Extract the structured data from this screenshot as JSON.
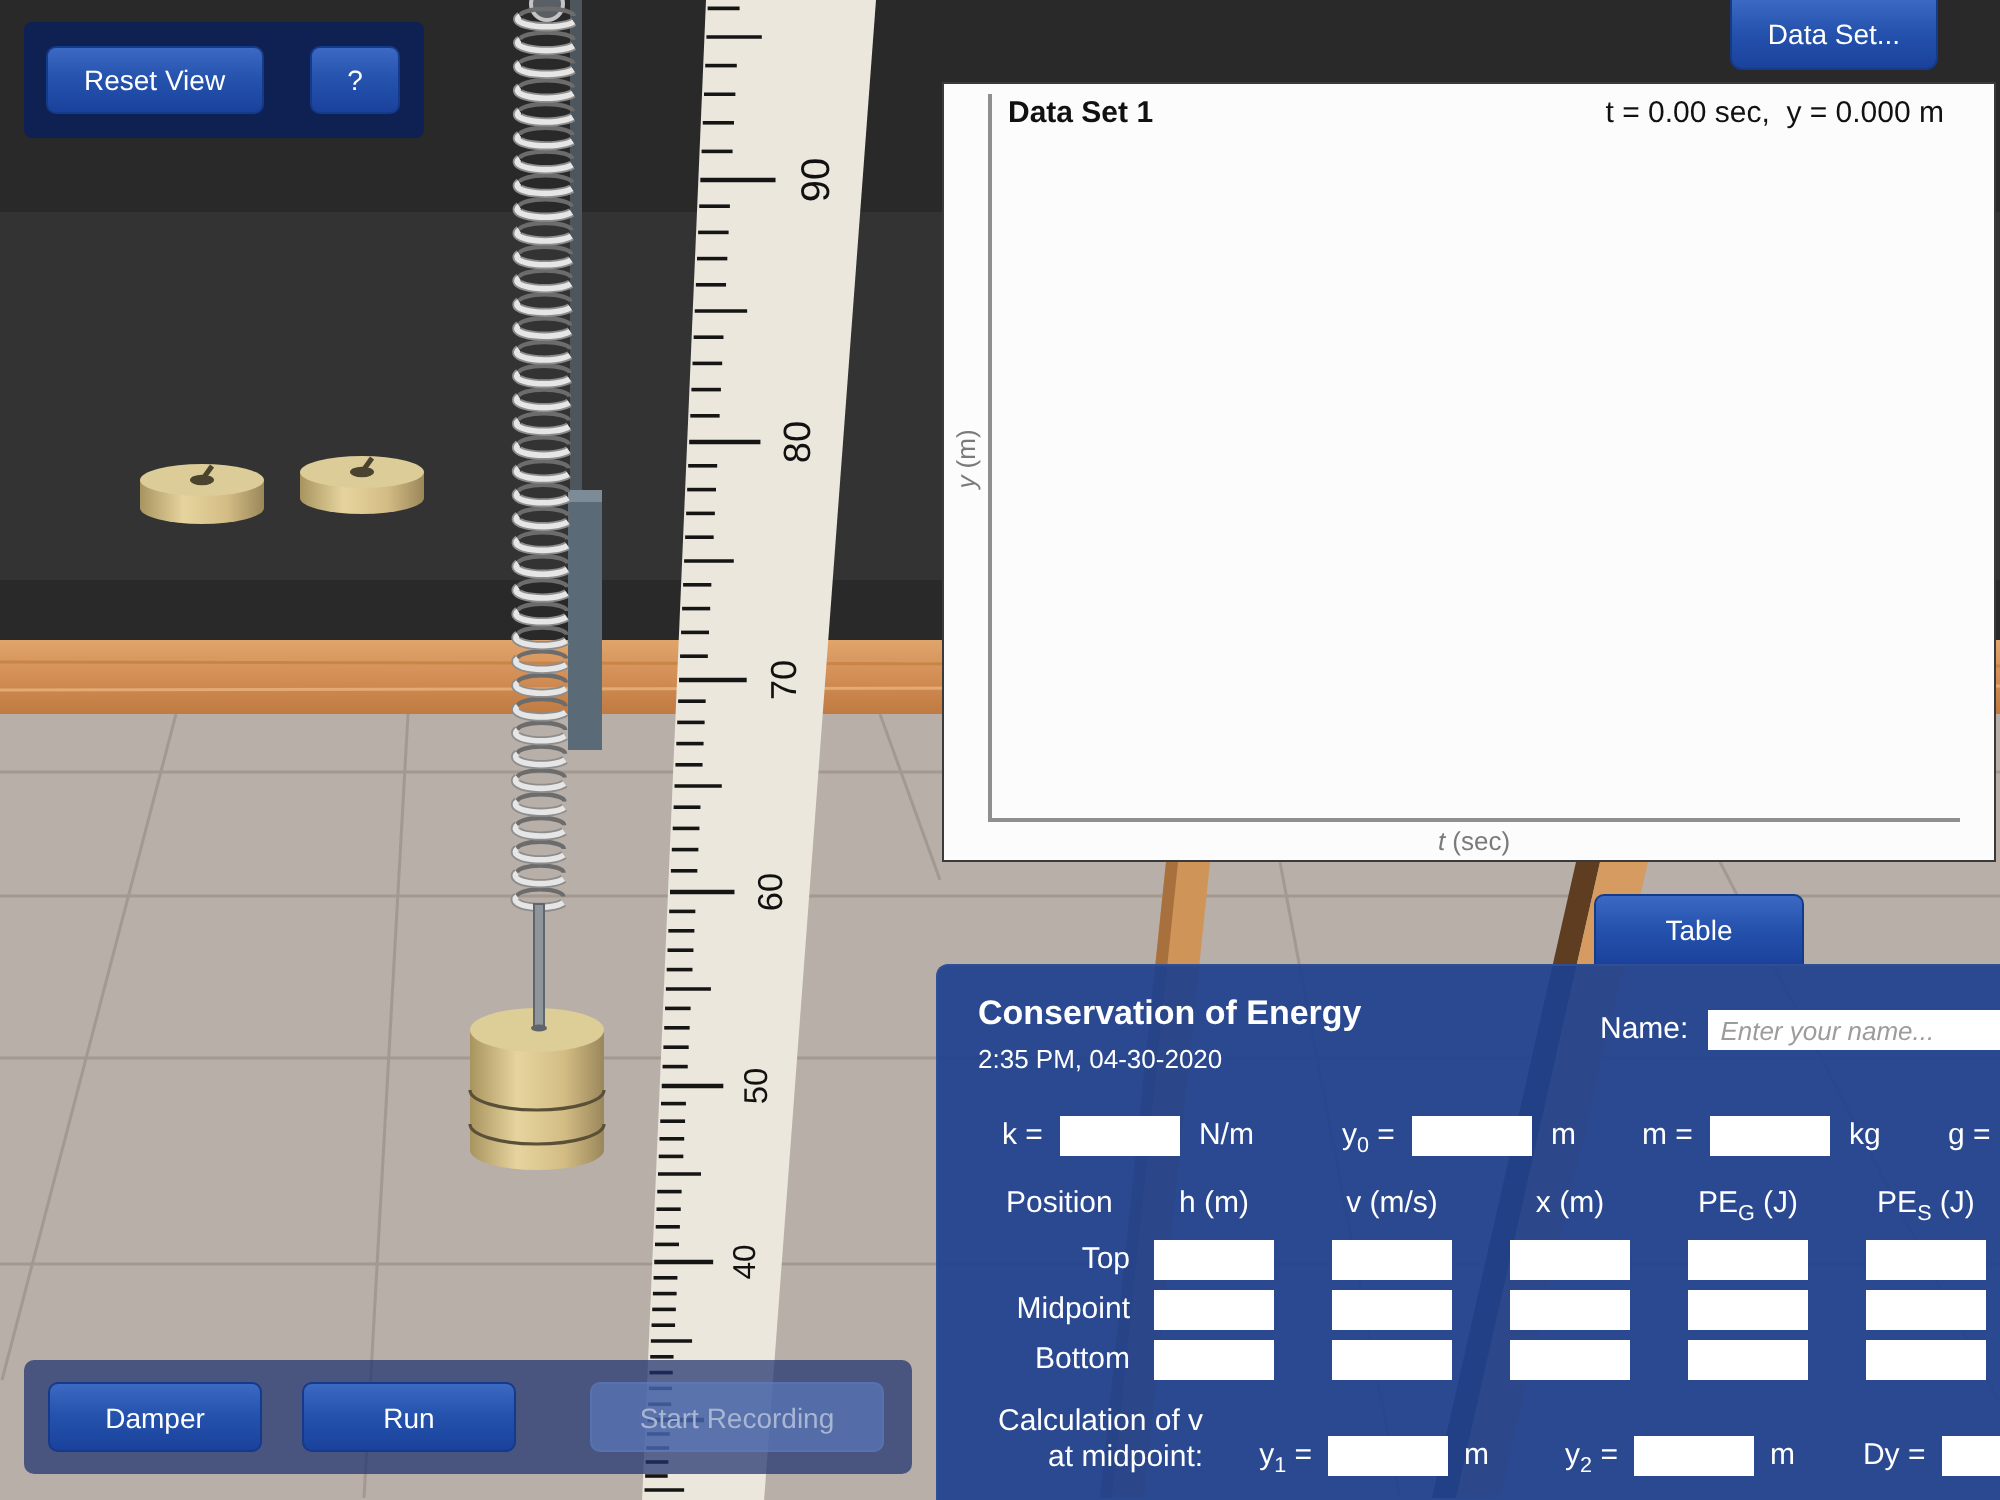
{
  "top_controls": {
    "buttons": [
      {
        "label": "Reset View"
      },
      {
        "label": "?"
      }
    ]
  },
  "data_set_button": {
    "label": "Data Set..."
  },
  "scene": {
    "ruler": {
      "labels": [
        "90",
        "80",
        "70",
        "60",
        "50",
        "40"
      ]
    }
  },
  "graph": {
    "title": "Data Set 1",
    "readout": "t = 0.00 sec,  y = 0.000 m",
    "y_axis_label": "*y* (m)",
    "x_axis_label": "*t* (sec)"
  },
  "table_tab": {
    "label": "Table"
  },
  "worksheet": {
    "title": "Conservation of Energy",
    "timestamp": "2:35 PM, 04-30-2020",
    "name_field": {
      "label": "Name:",
      "placeholder": "Enter your name..."
    },
    "constants": [
      {
        "kind": "entry",
        "label": "k =",
        "unit": "N/m"
      },
      {
        "kind": "entry",
        "label": "y$_{0}$ =",
        "unit": "m"
      },
      {
        "kind": "entry",
        "label": "m =",
        "unit": "kg"
      },
      {
        "kind": "label",
        "label": "g ="
      }
    ],
    "columns": [
      "Position",
      "h (m)",
      "v (m/s)",
      "x (m)",
      "PE$_{G}$ (J)",
      "PE$_{S}$ (J)"
    ],
    "rows": [
      "Top",
      "Midpoint",
      "Bottom"
    ],
    "calculation": {
      "label_lines": [
        "Calculation of v",
        "at midpoint:"
      ],
      "fields": [
        {
          "label": "y$_{1}$ =",
          "unit": "m"
        },
        {
          "label": "y$_{2}$ =",
          "unit": "m"
        },
        {
          "label": "Dy ="
        }
      ]
    }
  },
  "bottom_controls": {
    "buttons": [
      {
        "label": "Damper",
        "disabled": false
      },
      {
        "label": "Run",
        "disabled": false
      },
      {
        "label": "Start Recording",
        "disabled": true
      }
    ]
  }
}
